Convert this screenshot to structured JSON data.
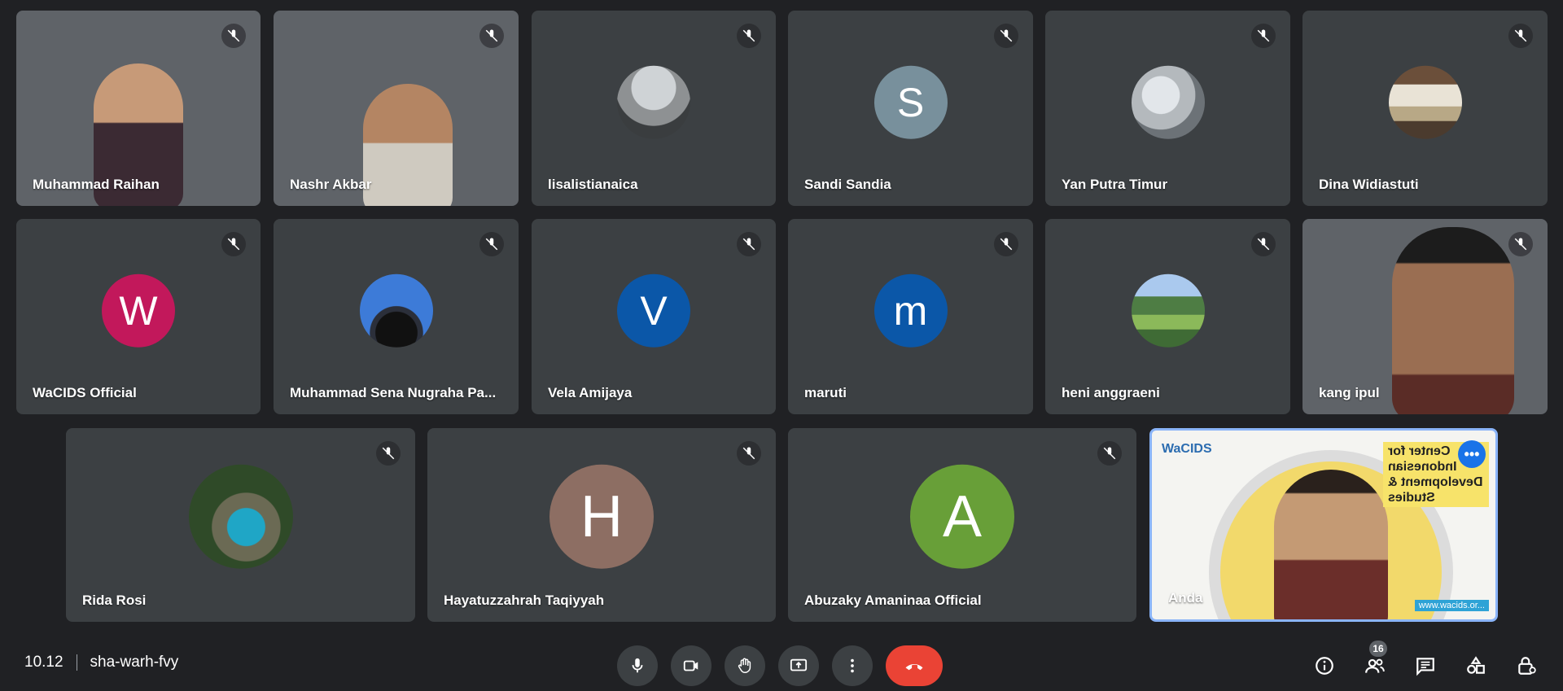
{
  "participants": [
    {
      "name": "Muhammad Raihan",
      "type": "video"
    },
    {
      "name": "Nashr Akbar",
      "type": "video"
    },
    {
      "name": "lisalistianaica",
      "type": "photo"
    },
    {
      "name": "Sandi Sandia",
      "type": "initial",
      "initial": "S",
      "color": "#78909c"
    },
    {
      "name": "Yan Putra Timur",
      "type": "photo"
    },
    {
      "name": "Dina Widiastuti",
      "type": "photo"
    },
    {
      "name": "WaCIDS Official",
      "type": "initial",
      "initial": "W",
      "color": "#c2185b"
    },
    {
      "name": "Muhammad Sena Nugraha Pa...",
      "type": "photo"
    },
    {
      "name": "Vela Amijaya",
      "type": "initial",
      "initial": "V",
      "color": "#0b57a8"
    },
    {
      "name": "maruti",
      "type": "initial",
      "initial": "m",
      "color": "#0b57a8"
    },
    {
      "name": "heni anggraeni",
      "type": "photo"
    },
    {
      "name": "kang ipul",
      "type": "video"
    },
    {
      "name": "Rida Rosi",
      "type": "photo"
    },
    {
      "name": "Hayatuzzahrah Taqiyyah",
      "type": "initial",
      "initial": "H",
      "color": "#8d6e63"
    },
    {
      "name": "Abuzaky Amaninaa Official",
      "type": "initial",
      "initial": "A",
      "color": "#689f38"
    }
  ],
  "self_tile": {
    "name": "Anda",
    "logo_text": "WaCIDS",
    "banner_text": "Center for Indonesian Development & Studies",
    "url_text": "www.wacids.or..."
  },
  "bottom_bar": {
    "time": "10.12",
    "meeting_code": "sha-warh-fvy",
    "participants_count": "16"
  },
  "colors": {
    "background": "#202124",
    "tile": "#3c4043",
    "end_call": "#ea4335",
    "self_border": "#8ab4f8"
  }
}
